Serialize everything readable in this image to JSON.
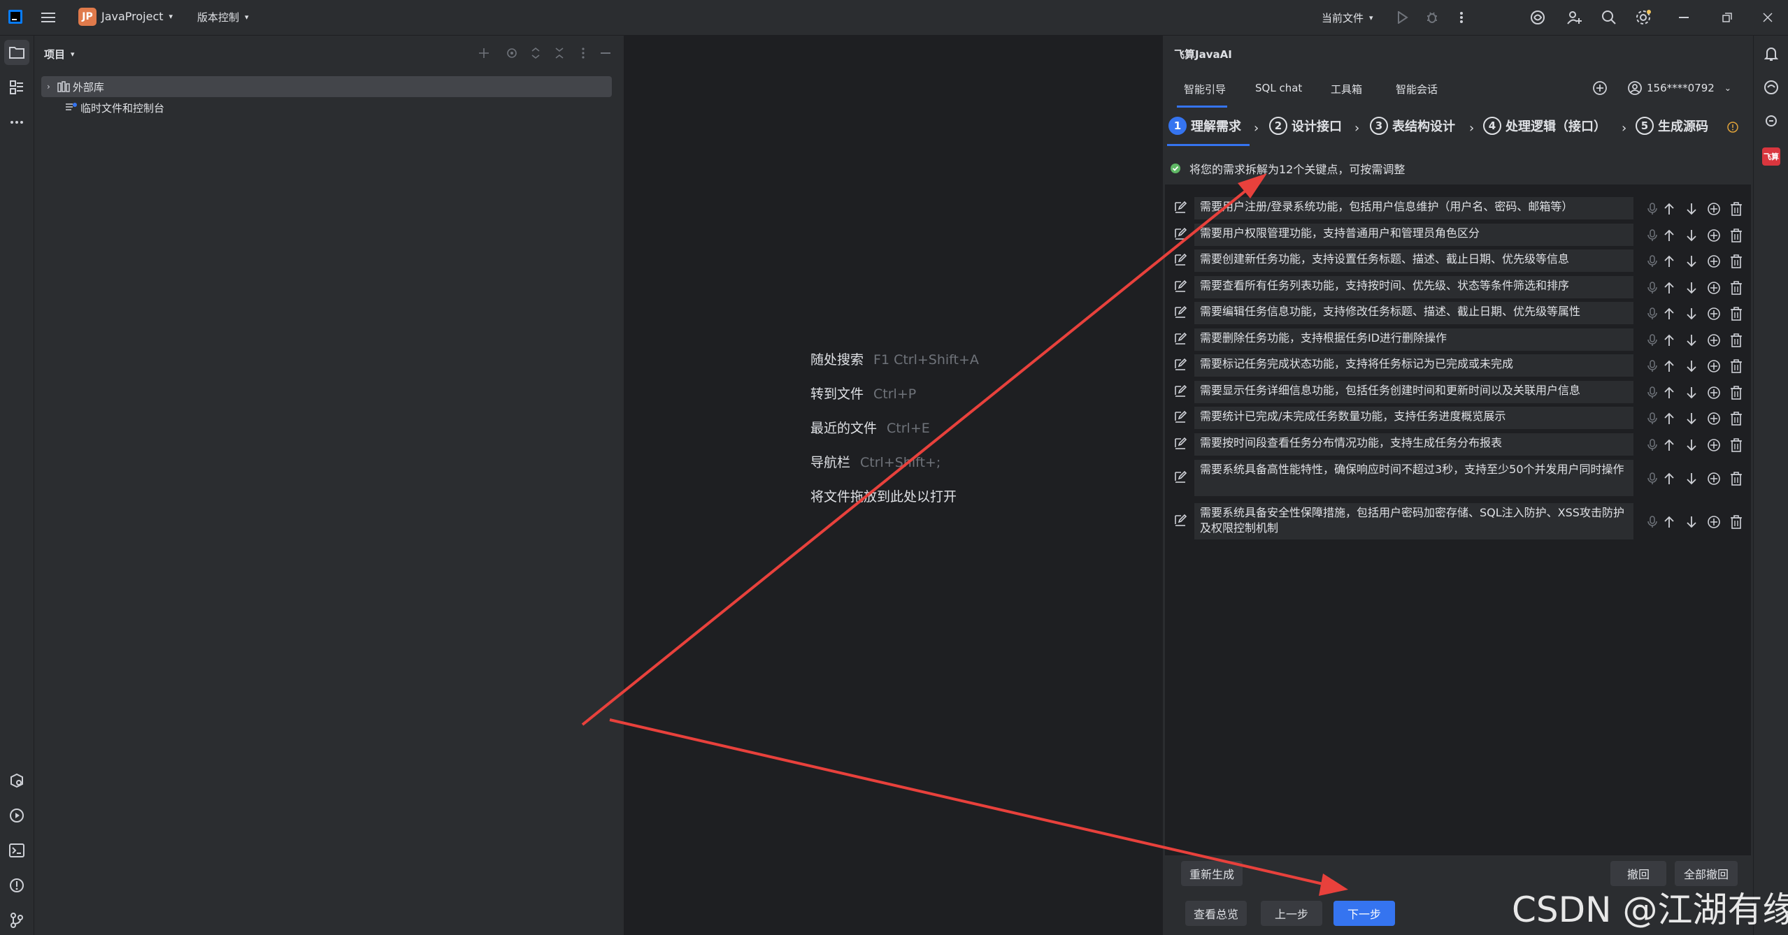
{
  "titlebar": {
    "project_badge": "JP",
    "project_name": "JavaProject",
    "vcs_label": "版本控制",
    "run_config": "当前文件"
  },
  "project_panel": {
    "title": "项目",
    "tree": [
      {
        "label": "外部库"
      },
      {
        "label": "临时文件和控制台"
      }
    ]
  },
  "editor": {
    "hints": [
      {
        "label": "随处搜索",
        "key": "F1 Ctrl+Shift+A"
      },
      {
        "label": "转到文件",
        "key": "Ctrl+P"
      },
      {
        "label": "最近的文件",
        "key": "Ctrl+E"
      },
      {
        "label": "导航栏",
        "key": "Ctrl+Shift+;"
      },
      {
        "label": "将文件拖放到此处以打开",
        "key": ""
      }
    ]
  },
  "ai_panel": {
    "title": "飞算JavaAI",
    "tabs": [
      "智能引导",
      "SQL chat",
      "工具箱",
      "智能会话"
    ],
    "account": "156****0792",
    "steps": [
      {
        "num": "1",
        "label": "理解需求"
      },
      {
        "num": "2",
        "label": "设计接口"
      },
      {
        "num": "3",
        "label": "表结构设计"
      },
      {
        "num": "4",
        "label": "处理逻辑（接口）"
      },
      {
        "num": "5",
        "label": "生成源码"
      }
    ],
    "status": "将您的需求拆解为12个关键点，可按需调整",
    "requirements": [
      "需要用户注册/登录系统功能，包括用户信息维护（用户名、密码、邮箱等）",
      "需要用户权限管理功能，支持普通用户和管理员角色区分",
      "需要创建新任务功能，支持设置任务标题、描述、截止日期、优先级等信息",
      "需要查看所有任务列表功能，支持按时间、优先级、状态等条件筛选和排序",
      "需要编辑任务信息功能，支持修改任务标题、描述、截止日期、优先级等属性",
      "需要删除任务功能，支持根据任务ID进行删除操作",
      "需要标记任务完成状态功能，支持将任务标记为已完成或未完成",
      "需要显示任务详细信息功能，包括任务创建时间和更新时间以及关联用户信息",
      "需要统计已完成/未完成任务数量功能，支持任务进度概览展示",
      "需要按时间段查看任务分布情况功能，支持生成任务分布报表",
      "需要系统具备高性能特性，确保响应时间不超过3秒，支持至少50个并发用户同时操作",
      "需要系统具备安全性保障措施，包括用户密码加密存储、SQL注入防护、XSS攻击防护及权限控制机制"
    ],
    "buttons": {
      "regenerate": "重新生成",
      "undo": "撤回",
      "undo_all": "全部撤回",
      "overview": "查看总览",
      "prev": "上一步",
      "next": "下一步"
    }
  },
  "right_strip": {
    "feisuan_badge": "飞算"
  },
  "watermark": "CSDN @江湖有缘",
  "colors": {
    "accent": "#3574f0",
    "arrow": "#e8413c",
    "status_ok": "#5fb865"
  }
}
